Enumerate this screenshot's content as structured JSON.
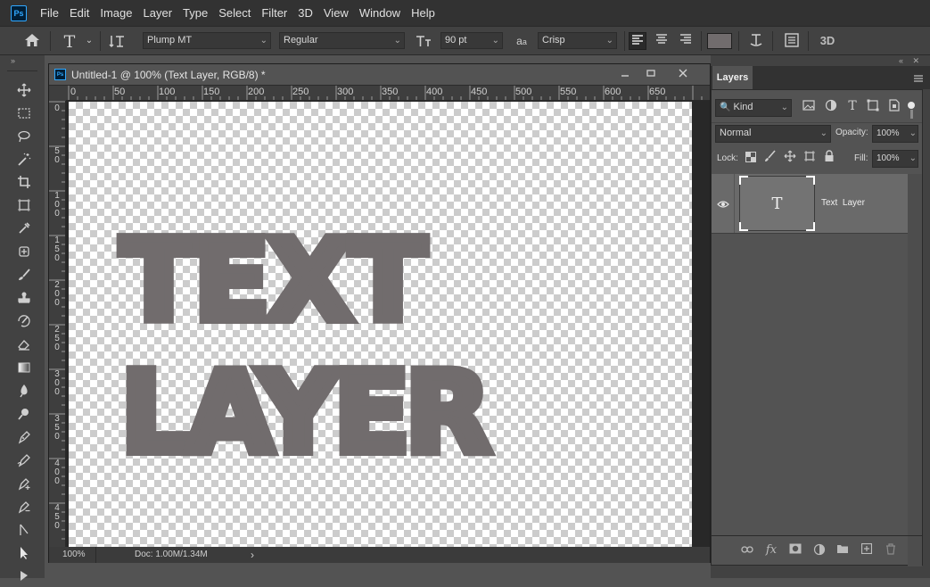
{
  "app": {
    "logo_text": "Ps"
  },
  "menu": [
    "File",
    "Edit",
    "Image",
    "Layer",
    "Type",
    "Select",
    "Filter",
    "3D",
    "View",
    "Window",
    "Help"
  ],
  "options_bar": {
    "font_family": "Plump MT",
    "font_style": "Regular",
    "font_size": "90 pt",
    "aa_icon_label": "a",
    "antialias": "Crisp",
    "color_swatch": "#716c6d",
    "threed_label": "3D"
  },
  "document": {
    "tab_title": "Untitled-1 @ 100% (Text  Layer, RGB/8) *",
    "ruler_top": [
      "0",
      "50",
      "100",
      "150",
      "200",
      "250",
      "300",
      "350",
      "400",
      "450",
      "500",
      "550",
      "600",
      "650"
    ],
    "ruler_left": [
      "0",
      "50",
      "100",
      "150",
      "200",
      "250",
      "300",
      "350",
      "400",
      "450"
    ],
    "canvas_text_line1": "TEXT",
    "canvas_text_line2": "LAYER",
    "text_color": "#716c6d",
    "zoom": "100%",
    "doc_info": "Doc: 1.00M/1.34M"
  },
  "layers_panel": {
    "tab_label": "Layers",
    "filter_kind": "Kind",
    "blend_mode": "Normal",
    "opacity_label": "Opacity:",
    "opacity_value": "100%",
    "lock_label": "Lock:",
    "fill_label": "Fill:",
    "fill_value": "100%",
    "layer_name": "Text  Layer",
    "layer_thumb_glyph": "T"
  }
}
